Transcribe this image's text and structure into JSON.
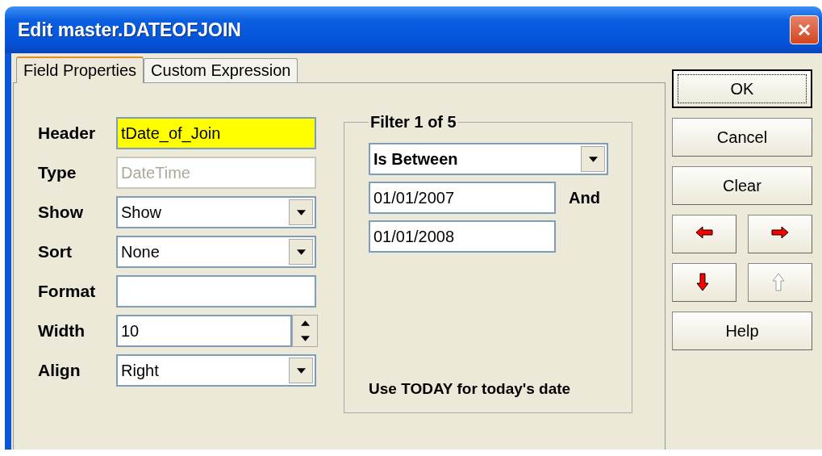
{
  "window": {
    "title": "Edit master.DATEOFJOIN"
  },
  "tabs": [
    {
      "label": "Field Properties",
      "selected": true
    },
    {
      "label": "Custom Expression",
      "selected": false
    }
  ],
  "fields": [
    {
      "label": "Header",
      "kind": "text",
      "value": "tDate_of_Join",
      "highlighted": true,
      "disabled": false
    },
    {
      "label": "Type",
      "kind": "text",
      "value": "DateTime",
      "highlighted": false,
      "disabled": true
    },
    {
      "label": "Show",
      "kind": "combo",
      "value": "Show",
      "highlighted": false,
      "disabled": false
    },
    {
      "label": "Sort",
      "kind": "combo",
      "value": "None",
      "highlighted": false,
      "disabled": false
    },
    {
      "label": "Format",
      "kind": "text",
      "highlighted": false,
      "disabled": false
    },
    {
      "label": "Width",
      "kind": "spin",
      "value": "10",
      "highlighted": false,
      "disabled": false
    },
    {
      "label": "Align",
      "kind": "combo",
      "value": "Right",
      "highlighted": false,
      "disabled": false
    }
  ],
  "filter": {
    "title": "Filter 1 of 5",
    "operator": "Is Between",
    "from": "01/01/2007",
    "and_label": "And",
    "to": "01/01/2008",
    "hint": "Use TODAY for today's date"
  },
  "buttons": [
    {
      "label": "OK",
      "default": true
    },
    {
      "label": "Cancel",
      "default": false
    },
    {
      "label": "Clear",
      "default": false
    }
  ],
  "arrows": [
    {
      "disabled": false
    },
    {
      "disabled": false
    },
    {
      "disabled": false
    },
    {
      "disabled": true
    }
  ],
  "help_button": {
    "label": "Help"
  }
}
